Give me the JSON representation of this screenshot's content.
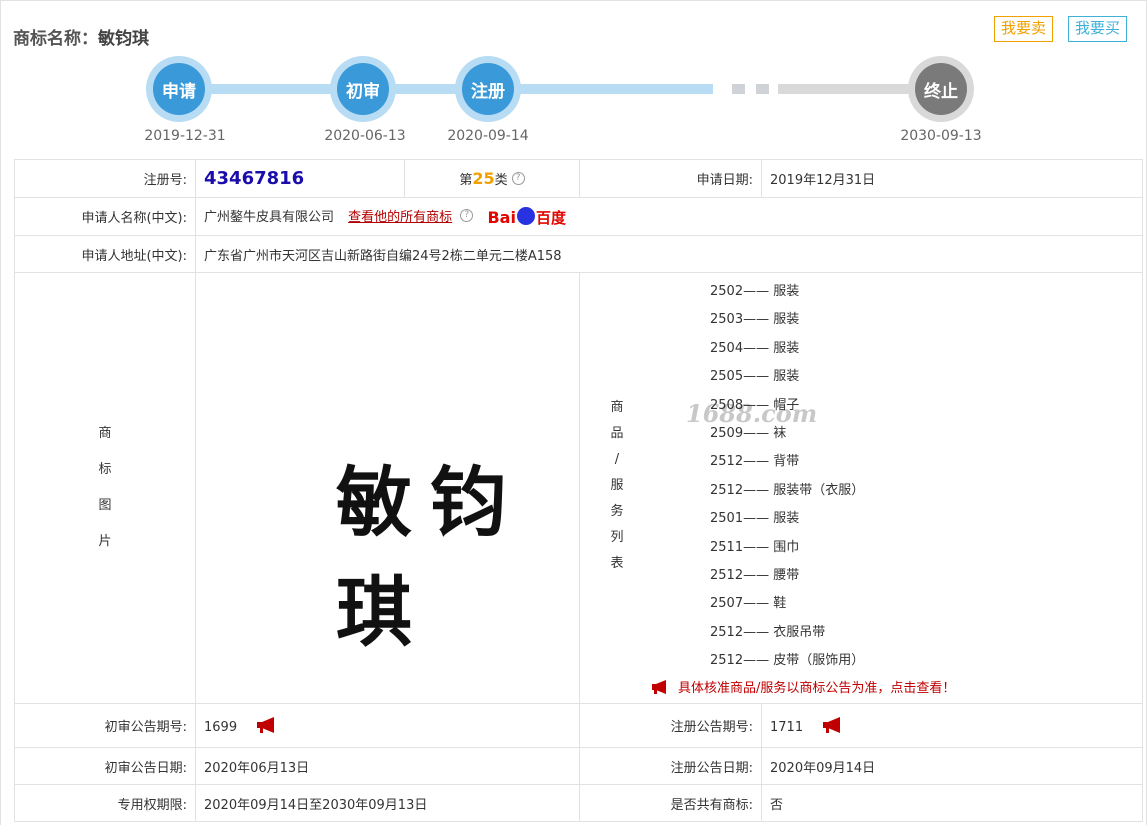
{
  "header": {
    "title_label": "商标名称：",
    "title_value": "敏钧琪",
    "sell_button": "我要卖",
    "buy_button": "我要买"
  },
  "timeline": {
    "steps": [
      {
        "label": "申请",
        "date": "2019-12-31"
      },
      {
        "label": "初审",
        "date": "2020-06-13"
      },
      {
        "label": "注册",
        "date": "2020-09-14"
      },
      {
        "label": "终止",
        "date": "2030-09-13"
      }
    ]
  },
  "info": {
    "reg_no_label": "注册号:",
    "reg_no": "43467816",
    "class_prefix": "第",
    "class_num": "25",
    "class_suffix": "类",
    "help_glyph": "?",
    "apply_date_label": "申请日期:",
    "apply_date": "2019年12月31日",
    "applicant_label": "申请人名称(中文):",
    "applicant": "广州鏊牛皮具有限公司",
    "view_all_link": "查看他的所有商标",
    "baidu_logo_text_a": "Bai",
    "baidu_logo_text_b": "百度",
    "address_label": "申请人地址(中文):",
    "address": "广东省广州市天河区吉山新路街自编24号2栋二单元二楼A158",
    "mark_image_label": [
      "商",
      "标",
      "图",
      "片"
    ],
    "mark_text": "敏钧琪",
    "watermark": "1688.com",
    "goods_label": [
      "商",
      "品",
      "/",
      "服",
      "务",
      "列",
      "表"
    ],
    "goods": [
      "2502—— 服装",
      "2503—— 服装",
      "2504—— 服装",
      "2505—— 服装",
      "2508—— 帽子",
      "2509—— 袜",
      "2512—— 背带",
      "2512—— 服装带（衣服）",
      "2501—— 服装",
      "2511—— 围巾",
      "2512—— 腰带",
      "2507—— 鞋",
      "2512—— 衣服吊带",
      "2512—— 皮带（服饰用）"
    ],
    "goods_notice": "具体核准商品/服务以商标公告为准，点击查看！",
    "prelim_no_label": "初审公告期号:",
    "prelim_no": "1699",
    "reg_announce_no_label": "注册公告期号:",
    "reg_announce_no": "1711",
    "prelim_date_label": "初审公告日期:",
    "prelim_date": "2020年06月13日",
    "reg_announce_date_label": "注册公告日期:",
    "reg_announce_date": "2020年09月14日",
    "exclusive_label": "专用权期限:",
    "exclusive": "2020年09月14日至2030年09月13日",
    "shared_label": "是否共有商标:",
    "shared": "否"
  },
  "colors": {
    "timeline_active": "#3a9ad9",
    "timeline_inactive": "#7a7a7a",
    "reg_no": "#1a0dab",
    "class_num": "#f0a000",
    "link": "#b30000"
  }
}
